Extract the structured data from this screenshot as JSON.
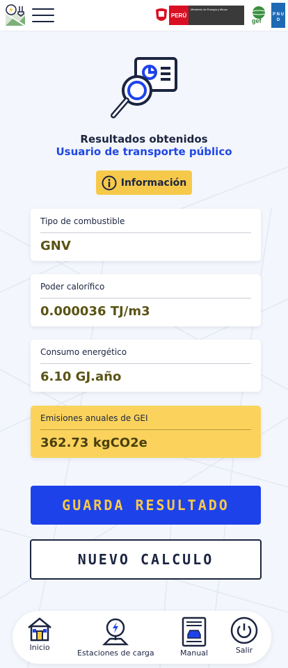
{
  "header": {
    "peru_label": "PERÚ",
    "ministry_label": "Ministerio de Energía y Minas",
    "gef_label": "gef",
    "pnud_label": "P N U D"
  },
  "result": {
    "title": "Resultados obtenidos",
    "subtitle": "Usuario de transporte público",
    "info_label": "Información"
  },
  "cards": [
    {
      "label": "Tipo de combustible",
      "value": "GNV"
    },
    {
      "label": "Poder calorífico",
      "value": "0.000036 TJ/m3"
    },
    {
      "label": "Consumo energético",
      "value": "6.10 GJ.año"
    },
    {
      "label": "Emisiones anuales de GEI",
      "value": "362.73 kgCO2e"
    }
  ],
  "actions": {
    "save_label": "GUARDA RESULTADO",
    "new_label": "NUEVO CALCULO"
  },
  "nav": [
    {
      "label": "Inicio",
      "icon": "home-icon"
    },
    {
      "label": "Estaciones de carga",
      "icon": "charging-station-icon"
    },
    {
      "label": "Manual",
      "icon": "manual-icon"
    },
    {
      "label": "Salir",
      "icon": "power-icon"
    }
  ],
  "colors": {
    "accent_blue": "#1e42ea",
    "accent_yellow": "#f7c94a",
    "dark_navy": "#1b2440"
  }
}
